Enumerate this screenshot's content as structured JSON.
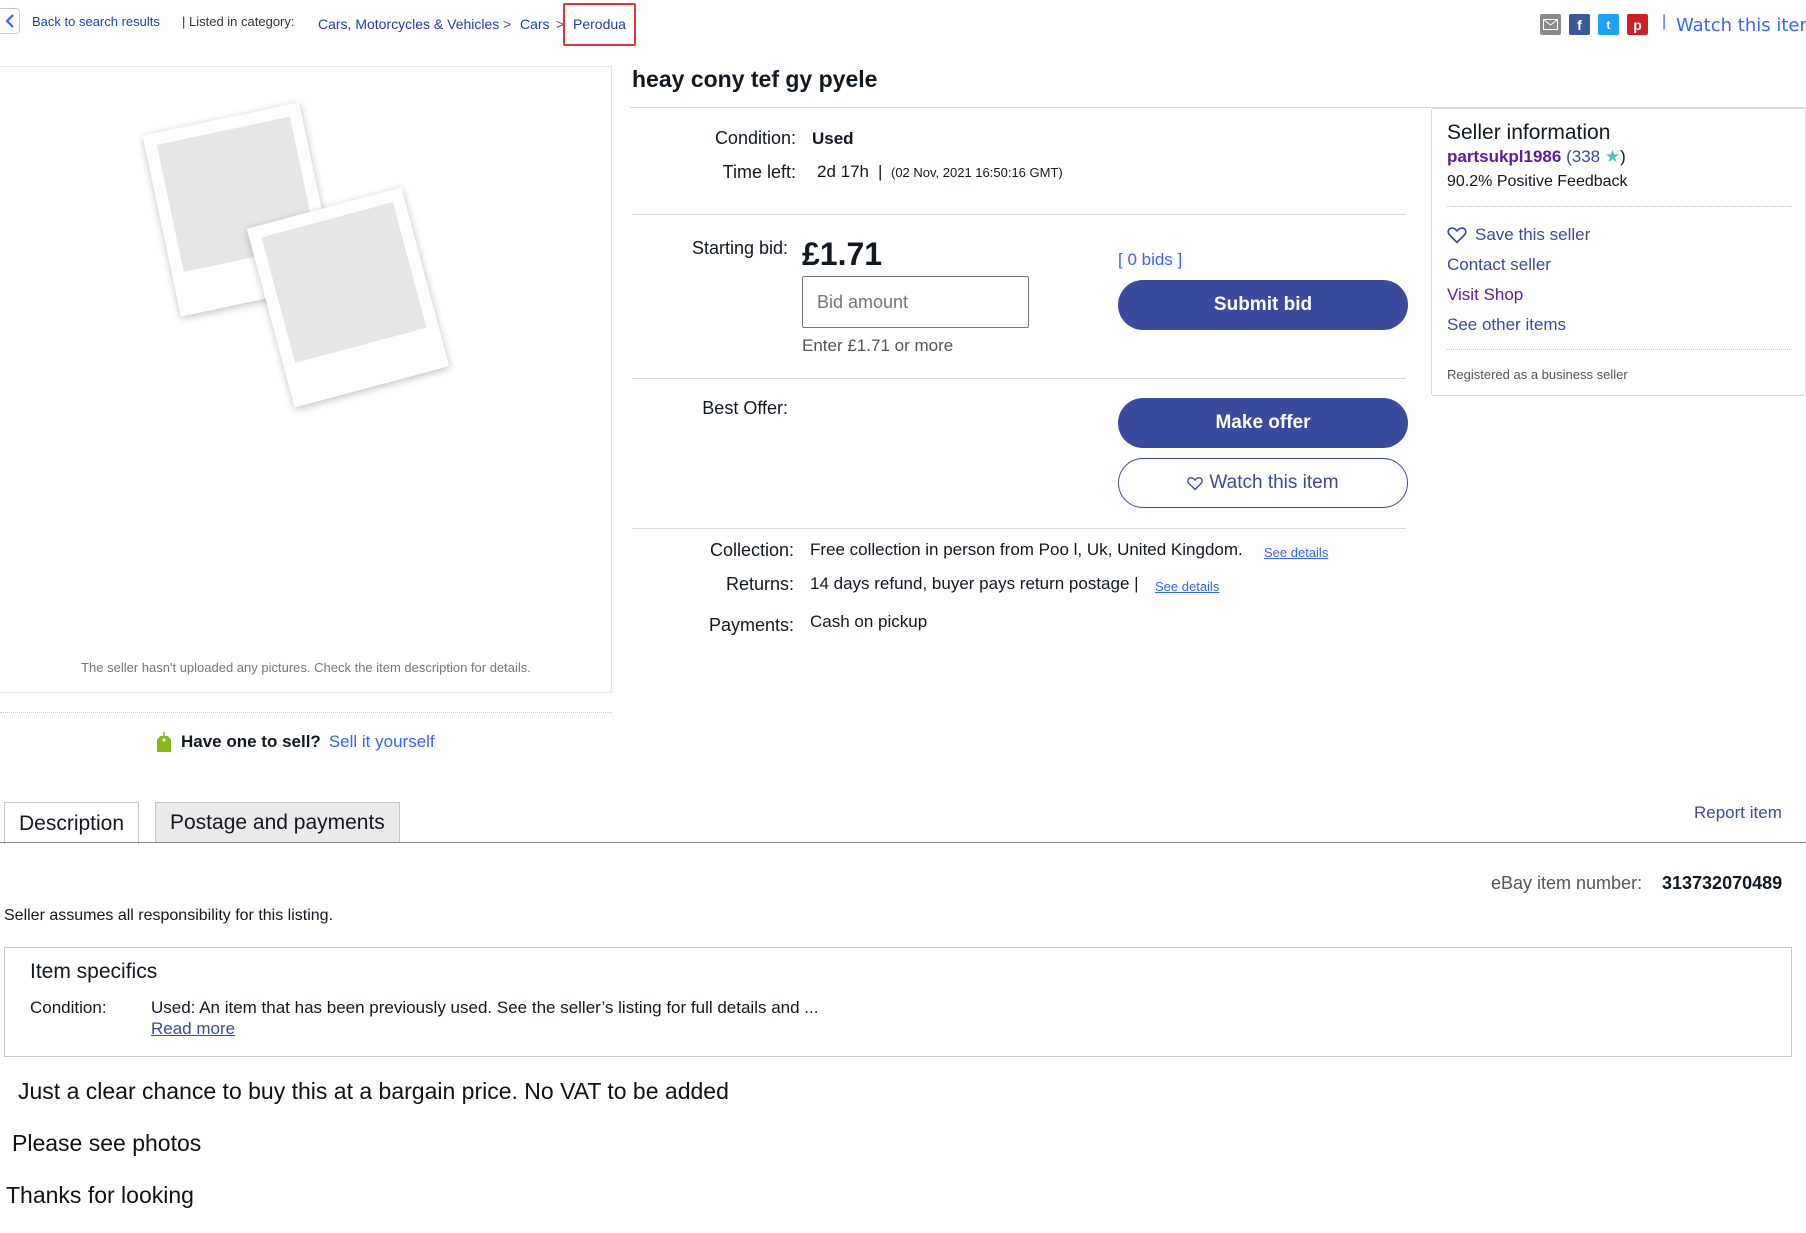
{
  "topbar": {
    "back_label": "Back to search results",
    "listed_label": "| Listed in category:",
    "crumbs": [
      "Cars, Motorcycles & Vehicles",
      "Cars",
      "Perodua"
    ],
    "crumb_separator": ">",
    "divider": "|",
    "watch_label": "Watch this item",
    "share_icons": [
      "email-icon",
      "facebook-icon",
      "twitter-icon",
      "pinterest-icon"
    ]
  },
  "gallery": {
    "no_pictures_text": "The seller hasn't uploaded any pictures. Check the item description for details."
  },
  "listing": {
    "title": "heay cony tef gy pyele",
    "condition_label": "Condition:",
    "condition_value": "Used",
    "time_left_label": "Time left:",
    "time_left_value": "2d 17h",
    "time_sep": "|",
    "end_time": "(02 Nov, 2021  16:50:16 GMT)",
    "starting_bid_label": "Starting bid:",
    "starting_bid_value": "£1.71",
    "bids_count": "[ 0 bids ]",
    "bid_placeholder": "Bid amount",
    "bid_hint": "Enter £1.71 or more",
    "submit_bid_label": "Submit bid",
    "best_offer_label": "Best Offer:",
    "make_offer_label": "Make offer",
    "watch_button_label": "Watch this item",
    "collection_label": "Collection:",
    "collection_value": "Free collection in person from Poo l, Uk, United Kingdom.",
    "returns_label": "Returns:",
    "returns_value": "14 days refund, buyer pays return postage |",
    "payments_label": "Payments:",
    "payments_value": "Cash on pickup",
    "see_details_label": "See details"
  },
  "seller": {
    "title": "Seller information",
    "username": "partsukpl1986",
    "feedback_score": "338",
    "positive_feedback": "90.2% Positive Feedback",
    "links": [
      "Save this seller",
      "Contact seller",
      "Visit Shop",
      "See other items"
    ],
    "registered": "Registered as a business seller"
  },
  "sell_prompt": {
    "question": "Have one to sell?",
    "link": "Sell it yourself"
  },
  "tabs": {
    "items": [
      "Description",
      "Postage and payments"
    ],
    "report_label": "Report item"
  },
  "description": {
    "item_number_label": "eBay item number:",
    "item_number": "313732070489",
    "responsibility": "Seller assumes all responsibility for this listing.",
    "specifics_title": "Item specifics",
    "specifics_condition_label": "Condition:",
    "specifics_condition_value": "Used: An item that has been previously used. See the seller’s listing for full details and ...",
    "read_more": "Read more",
    "lines": [
      "Just a clear chance to buy this at a bargain price. No VAT to be added",
      "Please see photos",
      "Thanks for looking"
    ]
  },
  "colors": {
    "primary_button": "#3b4a9c",
    "link": "#3665f3",
    "highlight_box": "#e0333a",
    "seller_name": "#5b1b9e",
    "star": "#4fc3b0"
  }
}
